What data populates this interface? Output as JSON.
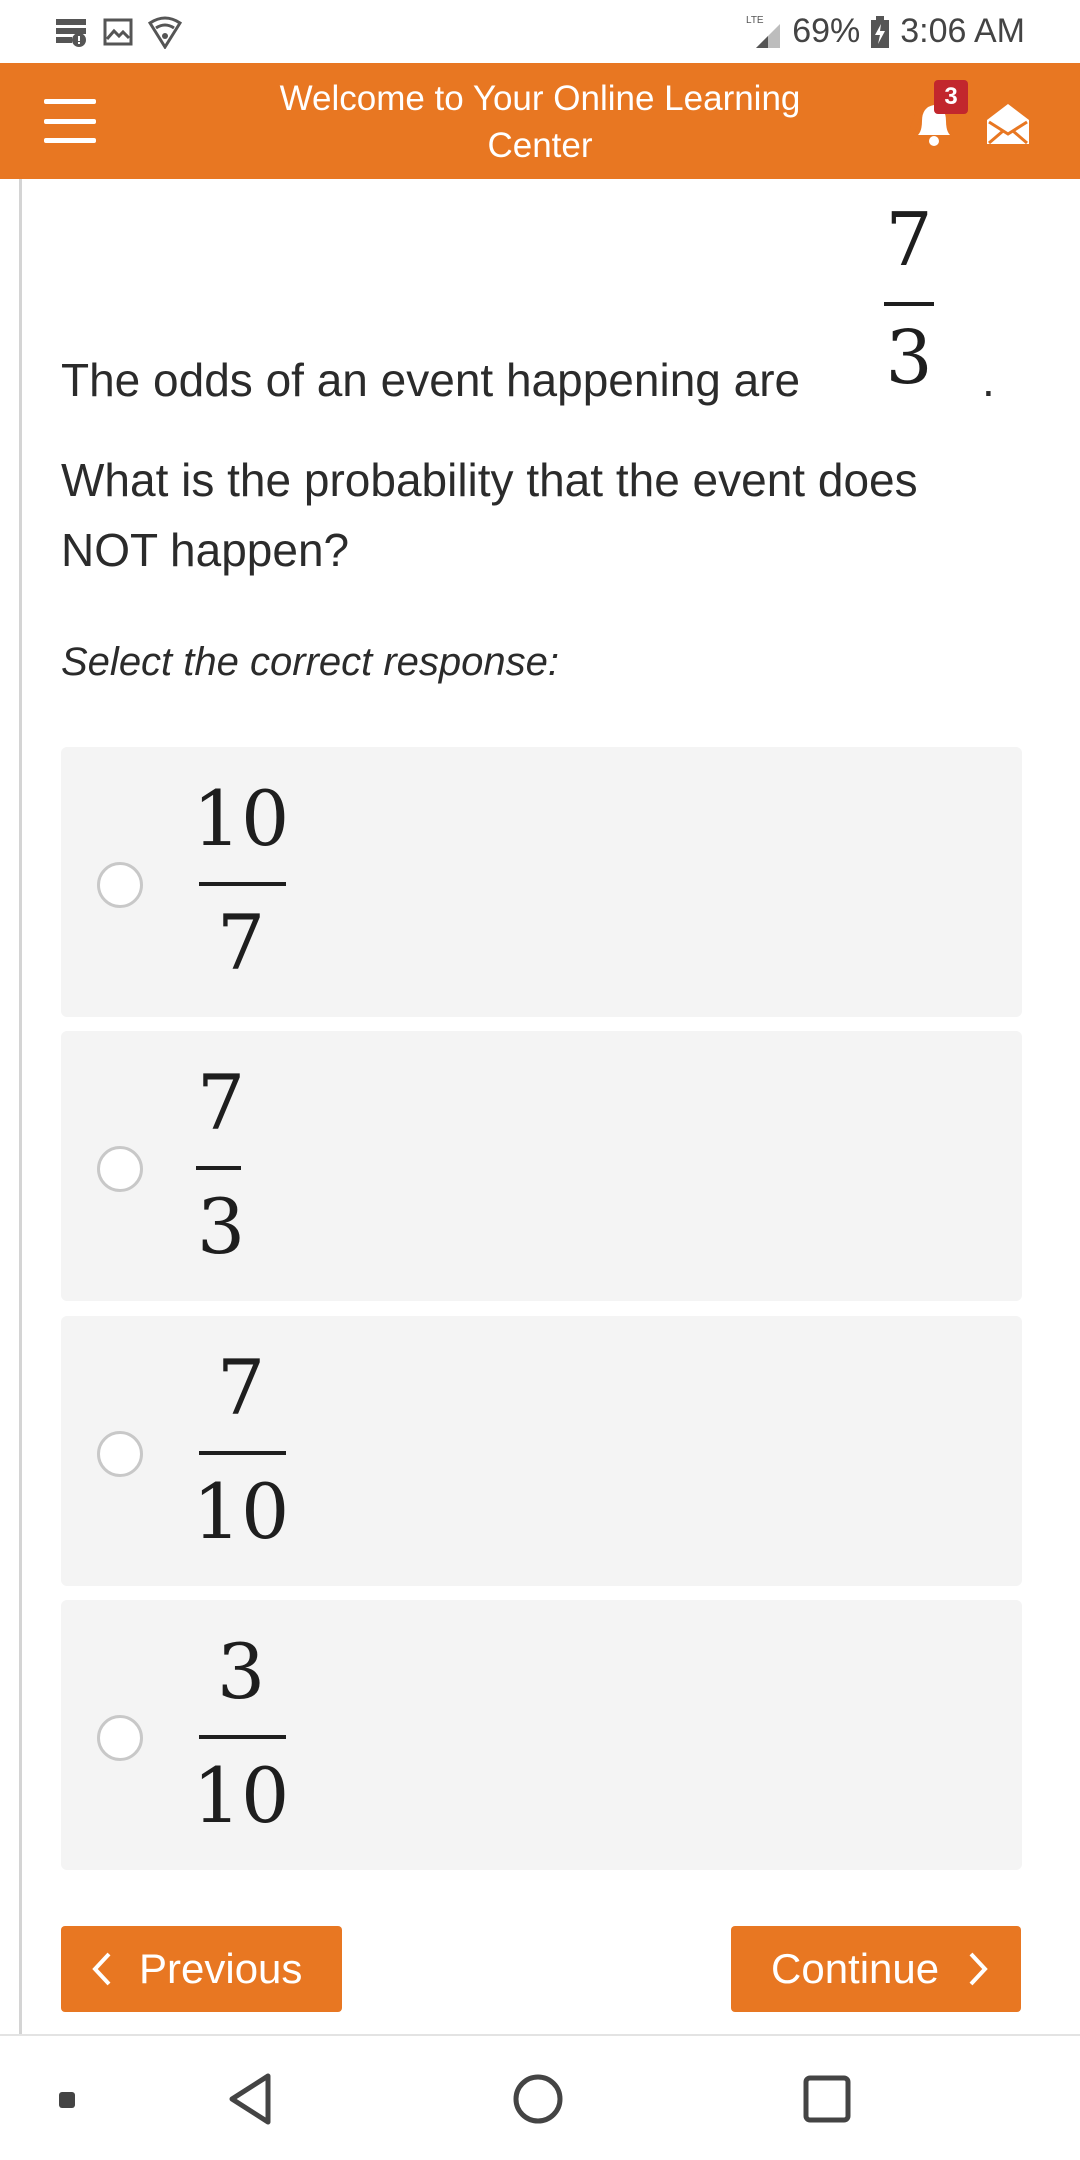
{
  "status_bar": {
    "network": "LTE",
    "battery": "69%",
    "time": "3:06 AM",
    "icons": [
      "notification-icon",
      "image-icon",
      "vpn-shield-icon",
      "signal-icon",
      "battery-charging-icon"
    ]
  },
  "header": {
    "title": "Welcome to Your Online Learning Center",
    "notification_count": "3",
    "accent_color": "#e87722",
    "badge_color": "#c2272d"
  },
  "question": {
    "prefix": "The odds of an event happening are",
    "fraction": {
      "numerator": "7",
      "denominator": "3"
    },
    "suffix": ".",
    "body": "What is the probability that the event does NOT happen?",
    "instruction": "Select the correct response:"
  },
  "options": [
    {
      "numerator": "10",
      "denominator": "7"
    },
    {
      "numerator": "7",
      "denominator": "3"
    },
    {
      "numerator": "7",
      "denominator": "10"
    },
    {
      "numerator": "3",
      "denominator": "10"
    }
  ],
  "navigation": {
    "previous_label": "Previous",
    "continue_label": "Continue"
  }
}
